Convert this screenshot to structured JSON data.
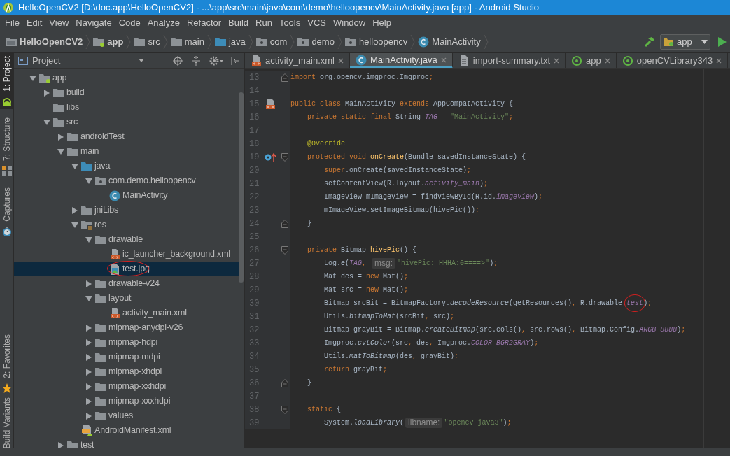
{
  "window": {
    "title": "HelloOpenCV2 [D:\\doc.app\\HelloOpenCV2] - ...\\app\\src\\main\\java\\com\\demo\\helloopencv\\MainActivity.java [app] - Android Studio"
  },
  "menu": [
    "File",
    "Edit",
    "View",
    "Navigate",
    "Code",
    "Analyze",
    "Refactor",
    "Build",
    "Run",
    "Tools",
    "VCS",
    "Window",
    "Help"
  ],
  "breadcrumbs": [
    {
      "label": "HelloOpenCV2",
      "kind": "project"
    },
    {
      "label": "app",
      "kind": "module"
    },
    {
      "label": "src",
      "kind": "folder"
    },
    {
      "label": "main",
      "kind": "folder"
    },
    {
      "label": "java",
      "kind": "source"
    },
    {
      "label": "com",
      "kind": "package"
    },
    {
      "label": "demo",
      "kind": "package"
    },
    {
      "label": "helloopencv",
      "kind": "package"
    },
    {
      "label": "MainActivity",
      "kind": "class"
    }
  ],
  "run_config": {
    "label": "app"
  },
  "tool_strip": {
    "top": [
      {
        "label": "1: Project",
        "kind": "android",
        "selected": true
      },
      {
        "label": "7: Structure",
        "kind": "structure",
        "selected": false
      },
      {
        "label": "Captures",
        "kind": "captures",
        "selected": false
      }
    ],
    "bottom": [
      {
        "label": "2: Favorites",
        "kind": "favorites",
        "selected": false
      },
      {
        "label": "Build Variants",
        "kind": "variants",
        "selected": false
      }
    ]
  },
  "project_panel": {
    "title": "Project",
    "tree": [
      {
        "label": "app",
        "kind": "module",
        "expanded": true,
        "selected": false,
        "children": [
          {
            "label": "build",
            "kind": "folder",
            "expanded": false,
            "selected": false
          },
          {
            "label": "libs",
            "kind": "folder",
            "selected": false
          },
          {
            "label": "src",
            "kind": "folder",
            "expanded": true,
            "selected": false,
            "children": [
              {
                "label": "androidTest",
                "kind": "folder",
                "expanded": false,
                "selected": false
              },
              {
                "label": "main",
                "kind": "folder",
                "expanded": true,
                "selected": false,
                "children": [
                  {
                    "label": "java",
                    "kind": "source",
                    "expanded": true,
                    "selected": false,
                    "children": [
                      {
                        "label": "com.demo.helloopencv",
                        "kind": "package",
                        "expanded": true,
                        "selected": false,
                        "children": [
                          {
                            "label": "MainActivity",
                            "kind": "class",
                            "selected": false
                          }
                        ]
                      }
                    ]
                  },
                  {
                    "label": "jniLibs",
                    "kind": "folder",
                    "expanded": false,
                    "selected": false
                  },
                  {
                    "label": "res",
                    "kind": "resources",
                    "expanded": true,
                    "selected": false,
                    "children": [
                      {
                        "label": "drawable",
                        "kind": "folder",
                        "expanded": true,
                        "selected": false,
                        "children": [
                          {
                            "label": "ic_launcher_background.xml",
                            "kind": "xml",
                            "selected": false
                          },
                          {
                            "label": "test.jpg",
                            "kind": "image",
                            "selected": true,
                            "circled": true
                          }
                        ]
                      },
                      {
                        "label": "drawable-v24",
                        "kind": "folder",
                        "expanded": false,
                        "selected": false
                      },
                      {
                        "label": "layout",
                        "kind": "folder",
                        "expanded": true,
                        "selected": false,
                        "children": [
                          {
                            "label": "activity_main.xml",
                            "kind": "xml",
                            "selected": false
                          }
                        ]
                      },
                      {
                        "label": "mipmap-anydpi-v26",
                        "kind": "folder",
                        "expanded": false,
                        "selected": false
                      },
                      {
                        "label": "mipmap-hdpi",
                        "kind": "folder",
                        "expanded": false,
                        "selected": false
                      },
                      {
                        "label": "mipmap-mdpi",
                        "kind": "folder",
                        "expanded": false,
                        "selected": false
                      },
                      {
                        "label": "mipmap-xhdpi",
                        "kind": "folder",
                        "expanded": false,
                        "selected": false
                      },
                      {
                        "label": "mipmap-xxhdpi",
                        "kind": "folder",
                        "expanded": false,
                        "selected": false
                      },
                      {
                        "label": "mipmap-xxxhdpi",
                        "kind": "folder",
                        "expanded": false,
                        "selected": false
                      },
                      {
                        "label": "values",
                        "kind": "folder",
                        "expanded": false,
                        "selected": false
                      }
                    ]
                  },
                  {
                    "label": "AndroidManifest.xml",
                    "kind": "manifest",
                    "selected": false
                  }
                ]
              },
              {
                "label": "test",
                "kind": "folder",
                "expanded": false,
                "selected": false
              }
            ]
          }
        ]
      }
    ]
  },
  "editor_tabs": [
    {
      "label": "activity_main.xml",
      "kind": "xml",
      "selected": false
    },
    {
      "label": "MainActivity.java",
      "kind": "class",
      "selected": true
    },
    {
      "label": "import-summary.txt",
      "kind": "text",
      "selected": false
    },
    {
      "label": "app",
      "kind": "gradle",
      "selected": false
    },
    {
      "label": "openCVLibrary343",
      "kind": "gradle",
      "selected": false
    }
  ],
  "code": [
    {
      "number": "13",
      "fold_end": true,
      "tokens": [
        {
          "kind": "kw",
          "text": "import"
        },
        {
          "kind": "plain",
          "text": " org.opencv.imgproc.Imgproc"
        },
        {
          "kind": "kw",
          "text": ";"
        }
      ]
    },
    {
      "number": "14"
    },
    {
      "number": "15",
      "kind": "layout_link",
      "tokens": [
        {
          "kind": "kw",
          "text": "public class"
        },
        {
          "kind": "plain",
          "text": " MainActivity "
        },
        {
          "kind": "kw",
          "text": "extends"
        },
        {
          "kind": "plain",
          "text": " AppCompatActivity {"
        }
      ]
    },
    {
      "number": "16",
      "tokens": [
        {
          "kind": "kw",
          "text": "    private static final"
        },
        {
          "kind": "plain",
          "text": " String "
        },
        {
          "kind": "field",
          "text": "TAG"
        },
        {
          "kind": "plain",
          "text": " = "
        },
        {
          "kind": "str",
          "text": "\"MainActivity\""
        },
        {
          "kind": "kw",
          "text": ";"
        }
      ]
    },
    {
      "number": "17"
    },
    {
      "number": "18",
      "tokens": [
        {
          "kind": "ann",
          "text": "    @Override"
        }
      ]
    },
    {
      "number": "19",
      "fold_start": true,
      "kind": "override",
      "tokens": [
        {
          "kind": "kw",
          "text": "    protected void "
        },
        {
          "kind": "decl",
          "text": "onCreate"
        },
        {
          "kind": "plain",
          "text": "(Bundle savedInstanceState) {"
        }
      ]
    },
    {
      "number": "20",
      "tokens": [
        {
          "kind": "kw",
          "text": "        super"
        },
        {
          "kind": "plain",
          "text": ".onCreate(savedInstanceState)"
        },
        {
          "kind": "kw",
          "text": ";"
        }
      ]
    },
    {
      "number": "21",
      "tokens": [
        {
          "kind": "plain",
          "text": "        setContentView(R.layout."
        },
        {
          "kind": "field",
          "text": "activity_main"
        },
        {
          "kind": "plain",
          "text": ")"
        },
        {
          "kind": "kw",
          "text": ";"
        }
      ]
    },
    {
      "number": "22",
      "tokens": [
        {
          "kind": "plain",
          "text": "        ImageView mImageView = findViewById(R.id."
        },
        {
          "kind": "field",
          "text": "imageView"
        },
        {
          "kind": "plain",
          "text": ")"
        },
        {
          "kind": "kw",
          "text": ";"
        }
      ]
    },
    {
      "number": "23",
      "tokens": [
        {
          "kind": "plain",
          "text": "        mImageView.setImageBitmap(hivePic())"
        },
        {
          "kind": "kw",
          "text": ";"
        }
      ]
    },
    {
      "number": "24",
      "fold_end": true,
      "tokens": [
        {
          "kind": "plain",
          "text": "    }"
        }
      ]
    },
    {
      "number": "25"
    },
    {
      "number": "26",
      "fold_start": true,
      "tokens": [
        {
          "kind": "kw",
          "text": "    private"
        },
        {
          "kind": "plain",
          "text": " Bitmap "
        },
        {
          "kind": "decl",
          "text": "hivePic"
        },
        {
          "kind": "plain",
          "text": "() {"
        }
      ]
    },
    {
      "number": "27",
      "tokens": [
        {
          "kind": "plain",
          "text": "        Log."
        },
        {
          "kind": "static",
          "text": "e"
        },
        {
          "kind": "plain",
          "text": "("
        },
        {
          "kind": "field",
          "text": "TAG"
        },
        {
          "kind": "kw",
          "text": ", "
        },
        {
          "kind": "hint",
          "text": "msg:"
        },
        {
          "kind": "str",
          "text": "\"hivePic: HHHA:0====>\""
        },
        {
          "kind": "plain",
          "text": ")"
        },
        {
          "kind": "kw",
          "text": ";"
        }
      ]
    },
    {
      "number": "28",
      "tokens": [
        {
          "kind": "plain",
          "text": "        Mat des = "
        },
        {
          "kind": "kw",
          "text": "new"
        },
        {
          "kind": "plain",
          "text": " Mat()"
        },
        {
          "kind": "kw",
          "text": ";"
        }
      ]
    },
    {
      "number": "29",
      "tokens": [
        {
          "kind": "plain",
          "text": "        Mat src = "
        },
        {
          "kind": "kw",
          "text": "new"
        },
        {
          "kind": "plain",
          "text": " Mat()"
        },
        {
          "kind": "kw",
          "text": ";"
        }
      ]
    },
    {
      "number": "30",
      "tokens": [
        {
          "kind": "plain",
          "text": "        Bitmap srcBit = BitmapFactory."
        },
        {
          "kind": "static",
          "text": "decodeResource"
        },
        {
          "kind": "plain",
          "text": "(getResources()"
        },
        {
          "kind": "kw",
          "text": ","
        },
        {
          "kind": "plain",
          "text": " R.drawable."
        },
        {
          "kind": "field",
          "text": "test",
          "circled": true
        },
        {
          "kind": "plain",
          "text": ")"
        },
        {
          "kind": "kw",
          "text": ";"
        }
      ]
    },
    {
      "number": "31",
      "tokens": [
        {
          "kind": "plain",
          "text": "        Utils."
        },
        {
          "kind": "static",
          "text": "bitmapToMat"
        },
        {
          "kind": "plain",
          "text": "(srcBit"
        },
        {
          "kind": "kw",
          "text": ","
        },
        {
          "kind": "plain",
          "text": " src)"
        },
        {
          "kind": "kw",
          "text": ";"
        }
      ]
    },
    {
      "number": "32",
      "tokens": [
        {
          "kind": "plain",
          "text": "        Bitmap grayBit = Bitmap."
        },
        {
          "kind": "static",
          "text": "createBitmap"
        },
        {
          "kind": "plain",
          "text": "(src.cols()"
        },
        {
          "kind": "kw",
          "text": ","
        },
        {
          "kind": "plain",
          "text": " src.rows()"
        },
        {
          "kind": "kw",
          "text": ","
        },
        {
          "kind": "plain",
          "text": " Bitmap.Config."
        },
        {
          "kind": "field",
          "text": "ARGB_8888"
        },
        {
          "kind": "plain",
          "text": ")"
        },
        {
          "kind": "kw",
          "text": ";"
        }
      ]
    },
    {
      "number": "33",
      "tokens": [
        {
          "kind": "plain",
          "text": "        Imgproc."
        },
        {
          "kind": "static",
          "text": "cvtColor"
        },
        {
          "kind": "plain",
          "text": "(src"
        },
        {
          "kind": "kw",
          "text": ","
        },
        {
          "kind": "plain",
          "text": " des"
        },
        {
          "kind": "kw",
          "text": ","
        },
        {
          "kind": "plain",
          "text": " Imgproc."
        },
        {
          "kind": "field",
          "text": "COLOR_BGR2GRAY"
        },
        {
          "kind": "plain",
          "text": ")"
        },
        {
          "kind": "kw",
          "text": ";"
        }
      ]
    },
    {
      "number": "34",
      "tokens": [
        {
          "kind": "plain",
          "text": "        Utils."
        },
        {
          "kind": "static",
          "text": "matToBitmap"
        },
        {
          "kind": "plain",
          "text": "(des"
        },
        {
          "kind": "kw",
          "text": ","
        },
        {
          "kind": "plain",
          "text": " grayBit)"
        },
        {
          "kind": "kw",
          "text": ";"
        }
      ]
    },
    {
      "number": "35",
      "tokens": [
        {
          "kind": "kw",
          "text": "        return"
        },
        {
          "kind": "plain",
          "text": " grayBit"
        },
        {
          "kind": "kw",
          "text": ";"
        }
      ]
    },
    {
      "number": "36",
      "fold_end": true,
      "tokens": [
        {
          "kind": "plain",
          "text": "    }"
        }
      ]
    },
    {
      "number": "37"
    },
    {
      "number": "38",
      "fold_start": true,
      "tokens": [
        {
          "kind": "kw",
          "text": "    static"
        },
        {
          "kind": "plain",
          "text": " {"
        }
      ]
    },
    {
      "number": "39",
      "tokens": [
        {
          "kind": "plain",
          "text": "        System."
        },
        {
          "kind": "static",
          "text": "loadLibrary"
        },
        {
          "kind": "plain",
          "text": "("
        },
        {
          "kind": "hint",
          "text": "libname:"
        },
        {
          "kind": "str",
          "text": "\"opencv_java3\""
        },
        {
          "kind": "plain",
          "text": ")"
        },
        {
          "kind": "kw",
          "text": ";"
        }
      ]
    }
  ]
}
